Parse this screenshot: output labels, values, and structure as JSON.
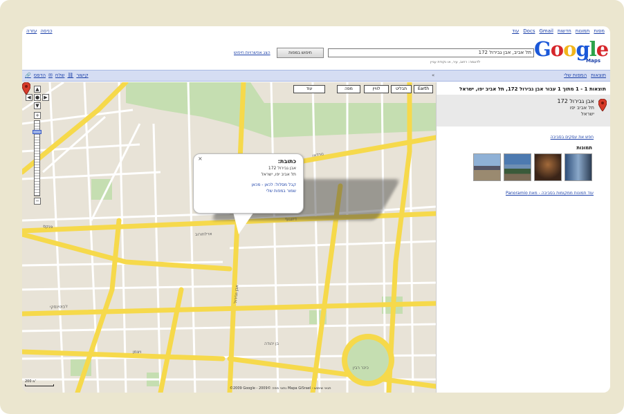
{
  "top_links": {
    "right": [
      "מפות",
      "תמונות",
      "חדשות",
      "Gmail",
      "Docs",
      "עוד"
    ],
    "left": [
      "כניסה",
      "עזרה"
    ]
  },
  "header": {
    "logo_text": "Google",
    "logo_subtext": "Maps",
    "search_value": "תל אביב, אבן גבירול 172",
    "search_button": "חיפוש במפות",
    "show_options": "הצג אפשרויות חיפוש",
    "search_hint": "לדוגמה: רחוב, עיר, או נקודת עניין"
  },
  "bluebar": {
    "left_links": [
      "הדפס",
      "שלח",
      "קישור"
    ],
    "right_links": [
      "תוצאות",
      "המפות שלי"
    ],
    "close": "«"
  },
  "map": {
    "map_types": [
      "עוד",
      "מפה",
      "לוויין",
      "תבליט",
      "Earth"
    ],
    "zoom_in": "+",
    "zoom_out": "−",
    "scale_text": "200 מ'",
    "copyright": "©2009 Google - נתוני מפה ©2009 Mapa GiSrael - תנאי שימוש",
    "street_labels": [
      "אבן גבירול",
      "ארלוזורוב",
      "דיזנגוף",
      "ז'בוטינסקי",
      "נורדאו",
      "פנקס",
      "בן יהודה",
      "ויצמן",
      "כיכר רבין"
    ]
  },
  "popup": {
    "title": "כתובת:",
    "line1": "אבן גבירול 172",
    "line2": "תל אביב יפו, ישראל",
    "links": "קבל מסלול: לכאן - מכאן",
    "more": "שמור במפות שלי",
    "close": "×"
  },
  "side": {
    "results_header": "תוצאות 1 - 1 מתוך 1 עבור אבן גבירול 172, תל אביב יפו, ישראל",
    "result_name": "אבן גבירול 172",
    "result_city": "תל אביב יפו",
    "result_country": "ישראל",
    "more_info": "חפש את עסקים בסביבה",
    "photos_label": "תמונות",
    "more_photos": "עוד תמונות ממקומות בסביבה - מאת Panoramio"
  },
  "colors": {
    "road_major": "#f6d94b",
    "road_minor": "#ffffff",
    "park": "#c5deb1",
    "land": "#e8e3d7",
    "link": "#1a3fa8"
  }
}
